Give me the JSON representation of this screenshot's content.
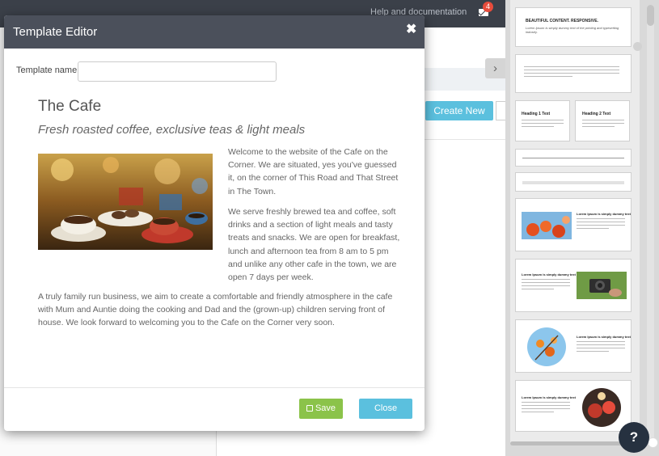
{
  "topbar": {
    "help_link": "Help and documentation",
    "notification_count": "4"
  },
  "background": {
    "create_new_label": "Create New"
  },
  "modal": {
    "title": "Template Editor",
    "close_glyph": "✖",
    "template_name_label": "Template name",
    "template_name_value": "",
    "save_label": "Save",
    "close_label": "Close"
  },
  "content": {
    "title": "The Cafe",
    "subtitle": "Fresh roasted coffee, exclusive teas & light meals",
    "paragraph_1": "Welcome to the website of the Cafe on the Corner. We are situated, yes you've guessed it, on the corner of This Road and That Street in The Town.",
    "paragraph_2": "We serve freshly brewed tea and coffee, soft drinks and a section of light meals and tasty treats and snacks. We are open for breakfast, lunch and afternoon tea from 8 am to 5 pm and unlike any other cafe in the town, we are open 7 days per week.",
    "paragraph_3": "A truly family run business, we aim to create a comfortable and friendly atmosphere in the cafe with Mum and Auntie doing the cooking and Dad and the (grown-up) children serving front of house. We look forward to welcoming you to the Cafe on the Corner very soon."
  },
  "snippets": {
    "thumb_1_title": "BEAUTIFUL CONTENT. RESPONSIVE.",
    "thumb_1_sub": "Lorem Ipsum is simply dummy text of the printing and typesetting industry.",
    "heading_1": "Heading 1 Text",
    "heading_2": "Heading 2 Text",
    "dummy_heading": "Lorem Ipsum is simply dummy text"
  },
  "colors": {
    "header": "#4b505b",
    "save": "#8bc34a",
    "close": "#5bc0de",
    "badge": "#e74c3c"
  },
  "icons": {
    "mail": "envelope-icon",
    "close": "close-icon",
    "save": "floppy-disk-icon",
    "panel_toggle": "chevron-right-icon",
    "help": "question-mark-icon"
  }
}
